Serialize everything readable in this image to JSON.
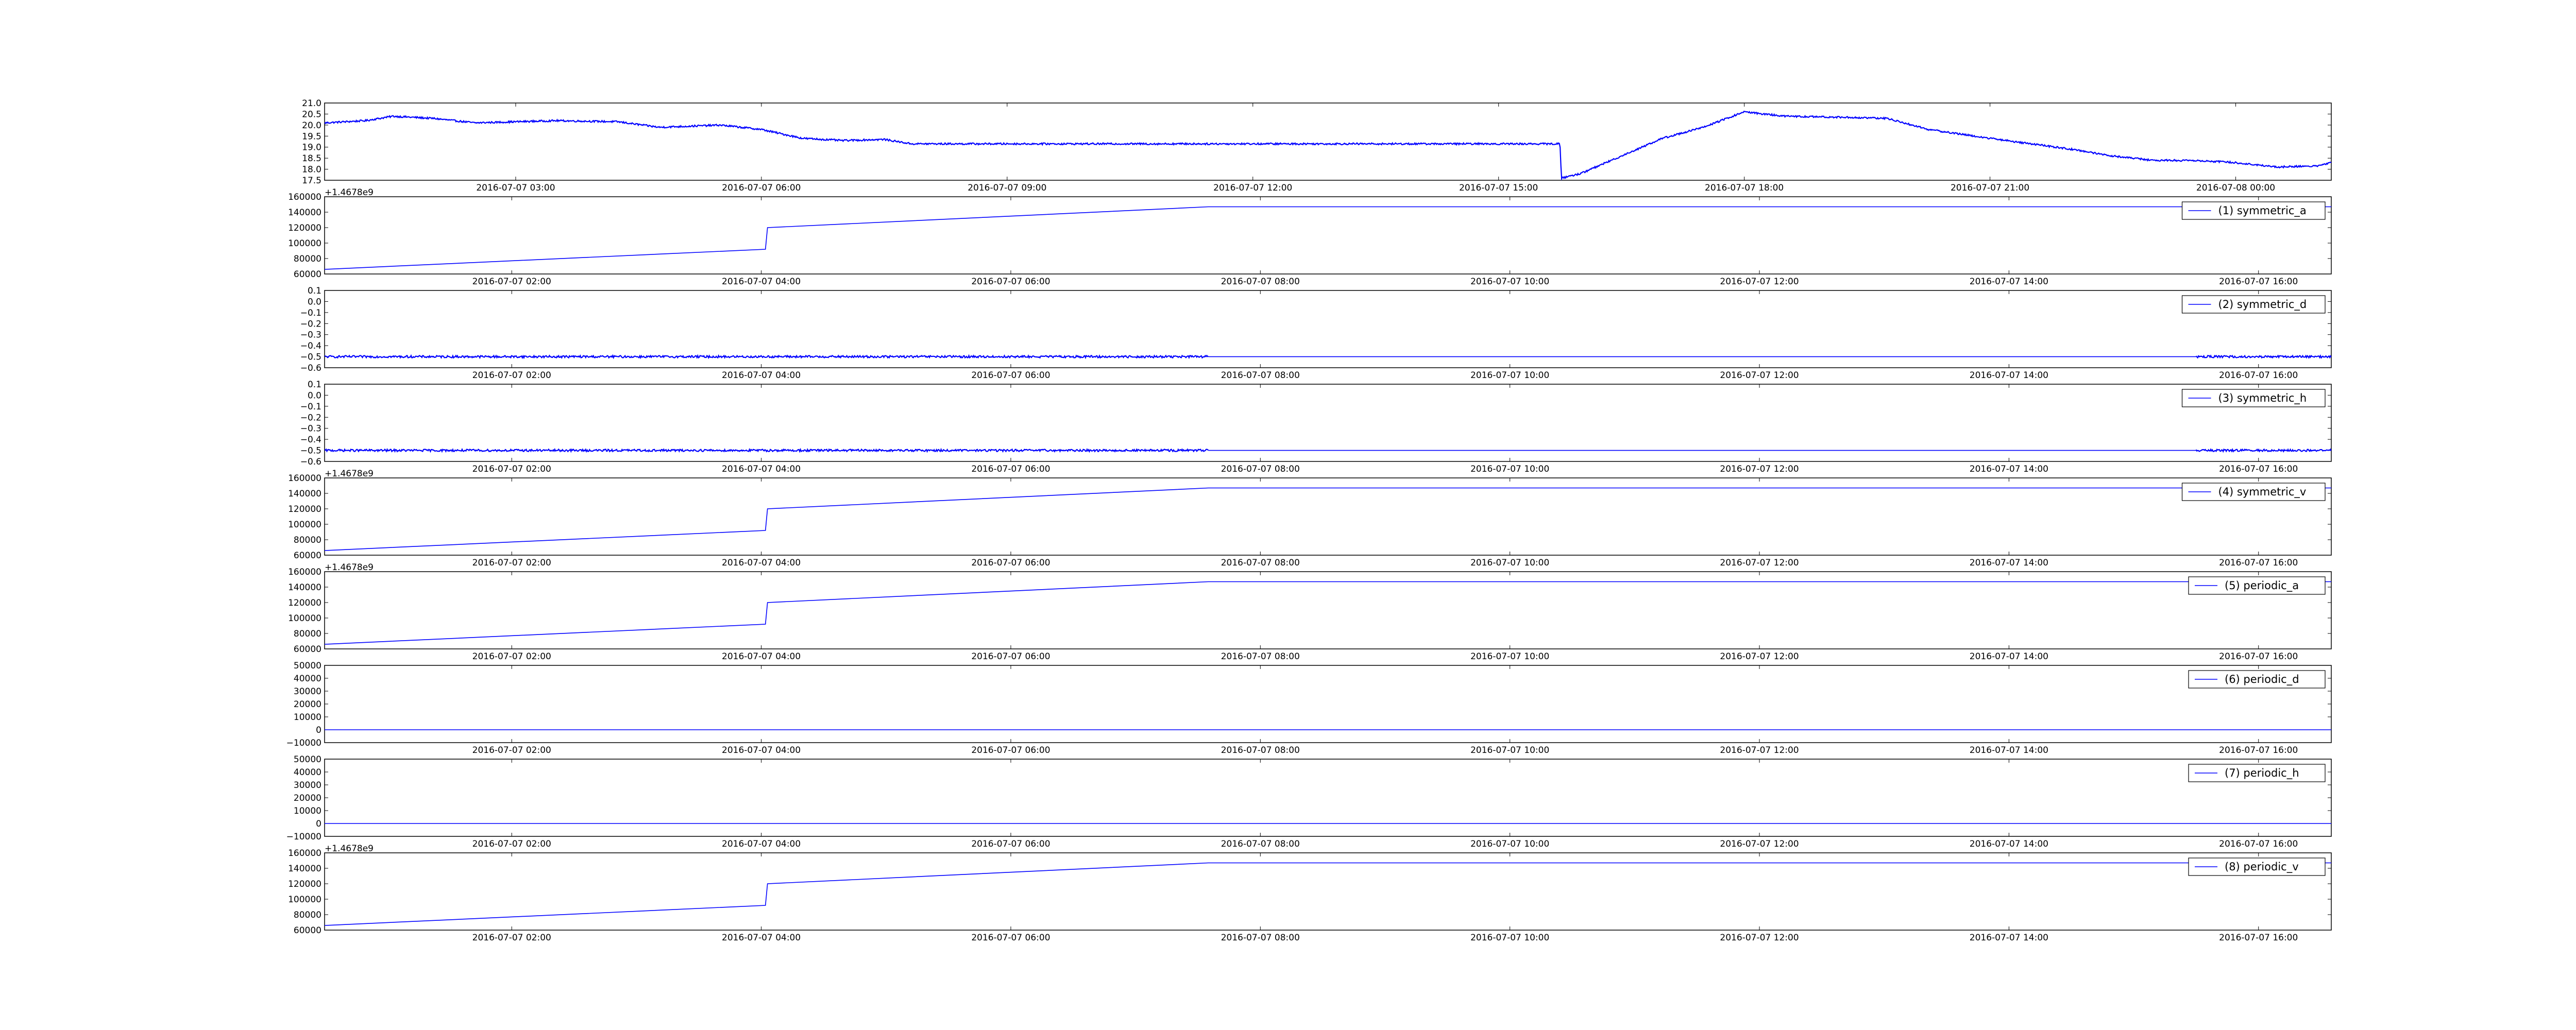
{
  "chart_data": [
    {
      "type": "line",
      "title": "",
      "line_color": "#0000ff",
      "xlim": [
        "2016-07-07 00:40",
        "2016-07-08 01:10"
      ],
      "xticks": [
        "2016-07-07 03:00",
        "2016-07-07 06:00",
        "2016-07-07 09:00",
        "2016-07-07 12:00",
        "2016-07-07 15:00",
        "2016-07-07 18:00",
        "2016-07-07 21:00",
        "2016-07-08 00:00"
      ],
      "ylim": [
        17.5,
        21.0
      ],
      "yticks": [
        "21.0",
        "20.5",
        "20.0",
        "19.5",
        "19.0",
        "18.5",
        "18.0",
        "17.5"
      ],
      "offset_text": "",
      "legend": "",
      "series": [
        {
          "noise": 0.04,
          "x": [
            "2016-07-07 00:40",
            "2016-07-07 01:10",
            "2016-07-07 01:30",
            "2016-07-07 02:00",
            "2016-07-07 02:30",
            "2016-07-07 03:30",
            "2016-07-07 04:15",
            "2016-07-07 04:45",
            "2016-07-07 05:30",
            "2016-07-07 06:00",
            "2016-07-07 06:30",
            "2016-07-07 07:00",
            "2016-07-07 07:30",
            "2016-07-07 07:45",
            "2016-07-07 07:50",
            "2016-07-07 15:45",
            "2016-07-07 15:46",
            "2016-07-07 16:00",
            "2016-07-07 16:30",
            "2016-07-07 17:00",
            "2016-07-07 17:30",
            "2016-07-07 18:00",
            "2016-07-07 18:30",
            "2016-07-07 19:15",
            "2016-07-07 19:45",
            "2016-07-07 20:15",
            "2016-07-07 21:00",
            "2016-07-07 22:00",
            "2016-07-07 22:30",
            "2016-07-07 23:00",
            "2016-07-07 23:30",
            "2016-07-08 00:00",
            "2016-07-08 00:30",
            "2016-07-08 01:00",
            "2016-07-08 01:10"
          ],
          "y": [
            20.1,
            20.2,
            20.4,
            20.3,
            20.1,
            20.2,
            20.15,
            19.9,
            20.0,
            19.8,
            19.4,
            19.3,
            19.35,
            19.2,
            19.15,
            19.15,
            17.6,
            17.8,
            18.6,
            19.4,
            19.9,
            20.6,
            20.4,
            20.35,
            20.3,
            19.8,
            19.4,
            18.9,
            18.6,
            18.4,
            18.4,
            18.3,
            18.1,
            18.15,
            18.3
          ]
        }
      ]
    },
    {
      "type": "line",
      "title": "",
      "line_color": "#0000ff",
      "xlim": [
        "2016-07-07 00:30",
        "2016-07-07 16:35"
      ],
      "xticks": [
        "2016-07-07 02:00",
        "2016-07-07 04:00",
        "2016-07-07 06:00",
        "2016-07-07 08:00",
        "2016-07-07 10:00",
        "2016-07-07 12:00",
        "2016-07-07 14:00",
        "2016-07-07 16:00"
      ],
      "ylim": [
        60000,
        160000
      ],
      "yticks": [
        "160000",
        "140000",
        "120000",
        "100000",
        "80000",
        "60000"
      ],
      "offset_text": "+1.4678e9",
      "legend": "(1) symmetric_a",
      "series": [
        {
          "noise": 0,
          "x": [
            "2016-07-07 00:30",
            "2016-07-07 04:02",
            "2016-07-07 04:03",
            "2016-07-07 07:35",
            "2016-07-07 16:35"
          ],
          "y": [
            66000,
            92000,
            120000,
            147000,
            147000
          ]
        }
      ]
    },
    {
      "type": "line",
      "title": "",
      "line_color": "#0000ff",
      "xlim": [
        "2016-07-07 00:30",
        "2016-07-07 16:35"
      ],
      "xticks": [
        "2016-07-07 02:00",
        "2016-07-07 04:00",
        "2016-07-07 06:00",
        "2016-07-07 08:00",
        "2016-07-07 10:00",
        "2016-07-07 12:00",
        "2016-07-07 14:00",
        "2016-07-07 16:00"
      ],
      "ylim": [
        -0.6,
        0.1
      ],
      "yticks": [
        "0.1",
        "0.0",
        "−0.1",
        "−0.2",
        "−0.3",
        "−0.4",
        "−0.5",
        "−0.6"
      ],
      "offset_text": "",
      "legend": "(2) symmetric_d",
      "series": [
        {
          "noise": 0.01,
          "x": [
            "2016-07-07 00:30",
            "2016-07-07 07:35"
          ],
          "y": [
            -0.5,
            -0.5
          ]
        },
        {
          "noise": 0,
          "x": [
            "2016-07-07 07:35",
            "2016-07-07 15:30"
          ],
          "y": [
            -0.5,
            -0.5
          ]
        },
        {
          "noise": 0.01,
          "x": [
            "2016-07-07 15:30",
            "2016-07-07 16:35"
          ],
          "y": [
            -0.5,
            -0.5
          ]
        }
      ]
    },
    {
      "type": "line",
      "title": "",
      "line_color": "#0000ff",
      "xlim": [
        "2016-07-07 00:30",
        "2016-07-07 16:35"
      ],
      "xticks": [
        "2016-07-07 02:00",
        "2016-07-07 04:00",
        "2016-07-07 06:00",
        "2016-07-07 08:00",
        "2016-07-07 10:00",
        "2016-07-07 12:00",
        "2016-07-07 14:00",
        "2016-07-07 16:00"
      ],
      "ylim": [
        -0.6,
        0.1
      ],
      "yticks": [
        "0.1",
        "0.0",
        "−0.1",
        "−0.2",
        "−0.3",
        "−0.4",
        "−0.5",
        "−0.6"
      ],
      "offset_text": "",
      "legend": "(3) symmetric_h",
      "series": [
        {
          "noise": 0.01,
          "x": [
            "2016-07-07 00:30",
            "2016-07-07 07:35"
          ],
          "y": [
            -0.5,
            -0.5
          ]
        },
        {
          "noise": 0,
          "x": [
            "2016-07-07 07:35",
            "2016-07-07 15:30"
          ],
          "y": [
            -0.5,
            -0.5
          ]
        },
        {
          "noise": 0.01,
          "x": [
            "2016-07-07 15:30",
            "2016-07-07 16:35"
          ],
          "y": [
            -0.5,
            -0.5
          ]
        }
      ]
    },
    {
      "type": "line",
      "title": "",
      "line_color": "#0000ff",
      "xlim": [
        "2016-07-07 00:30",
        "2016-07-07 16:35"
      ],
      "xticks": [
        "2016-07-07 02:00",
        "2016-07-07 04:00",
        "2016-07-07 06:00",
        "2016-07-07 08:00",
        "2016-07-07 10:00",
        "2016-07-07 12:00",
        "2016-07-07 14:00",
        "2016-07-07 16:00"
      ],
      "ylim": [
        60000,
        160000
      ],
      "yticks": [
        "160000",
        "140000",
        "120000",
        "100000",
        "80000",
        "60000"
      ],
      "offset_text": "+1.4678e9",
      "legend": "(4) symmetric_v",
      "series": [
        {
          "noise": 0,
          "x": [
            "2016-07-07 00:30",
            "2016-07-07 04:02",
            "2016-07-07 04:03",
            "2016-07-07 07:35",
            "2016-07-07 16:35"
          ],
          "y": [
            66000,
            92000,
            120000,
            147000,
            147000
          ]
        }
      ]
    },
    {
      "type": "line",
      "title": "",
      "line_color": "#0000ff",
      "xlim": [
        "2016-07-07 00:30",
        "2016-07-07 16:35"
      ],
      "xticks": [
        "2016-07-07 02:00",
        "2016-07-07 04:00",
        "2016-07-07 06:00",
        "2016-07-07 08:00",
        "2016-07-07 10:00",
        "2016-07-07 12:00",
        "2016-07-07 14:00",
        "2016-07-07 16:00"
      ],
      "ylim": [
        60000,
        160000
      ],
      "yticks": [
        "160000",
        "140000",
        "120000",
        "100000",
        "80000",
        "60000"
      ],
      "offset_text": "+1.4678e9",
      "legend": "(5) periodic_a",
      "series": [
        {
          "noise": 0,
          "x": [
            "2016-07-07 00:30",
            "2016-07-07 04:02",
            "2016-07-07 04:03",
            "2016-07-07 07:35",
            "2016-07-07 16:35"
          ],
          "y": [
            66000,
            92000,
            120000,
            147000,
            147000
          ]
        }
      ]
    },
    {
      "type": "line",
      "title": "",
      "line_color": "#0000ff",
      "xlim": [
        "2016-07-07 00:30",
        "2016-07-07 16:35"
      ],
      "xticks": [
        "2016-07-07 02:00",
        "2016-07-07 04:00",
        "2016-07-07 06:00",
        "2016-07-07 08:00",
        "2016-07-07 10:00",
        "2016-07-07 12:00",
        "2016-07-07 14:00",
        "2016-07-07 16:00"
      ],
      "ylim": [
        -10000,
        50000
      ],
      "yticks": [
        "50000",
        "40000",
        "30000",
        "20000",
        "10000",
        "0",
        "−10000"
      ],
      "offset_text": "",
      "legend": "(6) periodic_d",
      "series": [
        {
          "noise": 0,
          "x": [
            "2016-07-07 00:30",
            "2016-07-07 16:35"
          ],
          "y": [
            0,
            0
          ]
        }
      ]
    },
    {
      "type": "line",
      "title": "",
      "line_color": "#0000ff",
      "xlim": [
        "2016-07-07 00:30",
        "2016-07-07 16:35"
      ],
      "xticks": [
        "2016-07-07 02:00",
        "2016-07-07 04:00",
        "2016-07-07 06:00",
        "2016-07-07 08:00",
        "2016-07-07 10:00",
        "2016-07-07 12:00",
        "2016-07-07 14:00",
        "2016-07-07 16:00"
      ],
      "ylim": [
        -10000,
        50000
      ],
      "yticks": [
        "50000",
        "40000",
        "30000",
        "20000",
        "10000",
        "0",
        "−10000"
      ],
      "offset_text": "",
      "legend": "(7) periodic_h",
      "series": [
        {
          "noise": 0,
          "x": [
            "2016-07-07 00:30",
            "2016-07-07 16:35"
          ],
          "y": [
            0,
            0
          ]
        }
      ]
    },
    {
      "type": "line",
      "title": "",
      "line_color": "#0000ff",
      "xlim": [
        "2016-07-07 00:30",
        "2016-07-07 16:35"
      ],
      "xticks": [
        "2016-07-07 02:00",
        "2016-07-07 04:00",
        "2016-07-07 06:00",
        "2016-07-07 08:00",
        "2016-07-07 10:00",
        "2016-07-07 12:00",
        "2016-07-07 14:00",
        "2016-07-07 16:00"
      ],
      "ylim": [
        60000,
        160000
      ],
      "yticks": [
        "160000",
        "140000",
        "120000",
        "100000",
        "80000",
        "60000"
      ],
      "offset_text": "+1.4678e9",
      "legend": "(8) periodic_v",
      "series": [
        {
          "noise": 0,
          "x": [
            "2016-07-07 00:30",
            "2016-07-07 04:02",
            "2016-07-07 04:03",
            "2016-07-07 07:35",
            "2016-07-07 16:35"
          ],
          "y": [
            66000,
            92000,
            120000,
            147000,
            147000
          ]
        }
      ]
    }
  ]
}
